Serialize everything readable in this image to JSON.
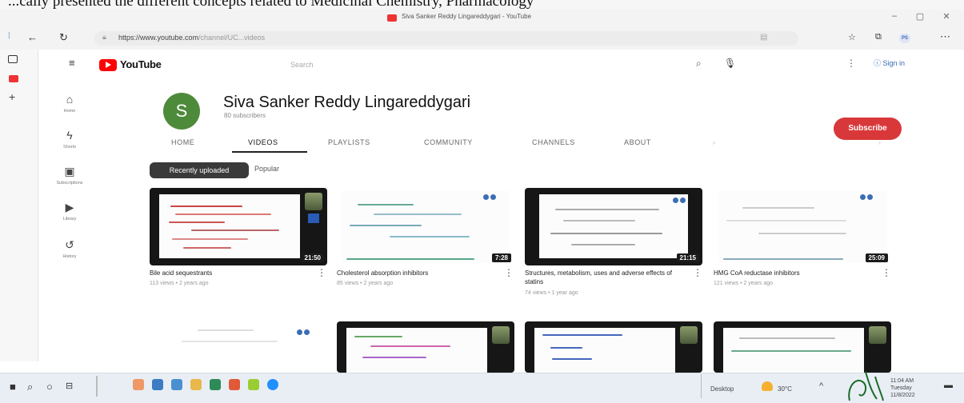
{
  "document_strip": {
    "text": "...cally presented the different concepts related to Medicinal Chemistry, Pharmacology"
  },
  "window": {
    "title": "Siva Sanker Reddy Lingareddygari - YouTube",
    "controls": {
      "minimize": "–",
      "maximize": "▢",
      "close": "✕"
    }
  },
  "browser": {
    "url_host": "https://www.youtube.com",
    "url_path": "/channel/UC...videos"
  },
  "header": {
    "wordmark": "YouTube",
    "search_placeholder": "Search",
    "sign_in": "Sign in"
  },
  "sidebar": {
    "items": [
      {
        "label": "Home",
        "icon": "home-icon"
      },
      {
        "label": "Shorts",
        "icon": "shorts-icon"
      },
      {
        "label": "Subscriptions",
        "icon": "subscriptions-icon"
      },
      {
        "label": "Library",
        "icon": "library-icon"
      },
      {
        "label": "History",
        "icon": "history-icon"
      }
    ]
  },
  "channel": {
    "avatar_letter": "S",
    "avatar_color": "#4d8a3a",
    "name": "Siva Sanker Reddy Lingareddygari",
    "subscribers": "80 subscribers",
    "subscribe_label": "Subscribe",
    "subscribe_color": "#d9383a"
  },
  "tabs": [
    {
      "label": "HOME"
    },
    {
      "label": "VIDEOS"
    },
    {
      "label": "PLAYLISTS"
    },
    {
      "label": "COMMUNITY"
    },
    {
      "label": "CHANNELS"
    },
    {
      "label": "ABOUT"
    }
  ],
  "active_tab": "VIDEOS",
  "chips": {
    "recent": "Recently uploaded",
    "popular": "Popular"
  },
  "videos": [
    {
      "title": "Bile acid sequestrants",
      "meta": "113 views • 2 years ago",
      "duration": "21:50"
    },
    {
      "title": "Cholesterol absorption inhibitors",
      "meta": "85 views • 2 years ago",
      "duration": "7:28"
    },
    {
      "title": "Structures, metabolism, uses and adverse effects of statins",
      "meta": "74 views • 1 year ago",
      "duration": "21:15"
    },
    {
      "title": "HMG CoA reductase inhibitors",
      "meta": "121 views • 2 years ago",
      "duration": "25:09"
    }
  ],
  "taskbar": {
    "desktop_label": "Desktop",
    "temperature": "30°C",
    "time": "11:04 AM",
    "day": "Tuesday",
    "date": "11/8/2022"
  }
}
